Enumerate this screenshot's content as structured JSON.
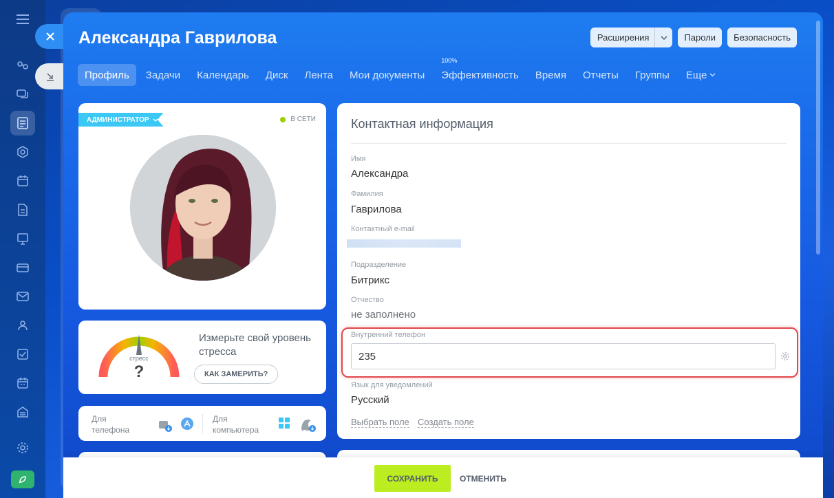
{
  "profile": {
    "name": "Александра Гаврилова"
  },
  "header_actions": {
    "extensions": "Расширения",
    "passwords": "Пароли",
    "security": "Безопасность"
  },
  "tabs": [
    {
      "label": "Профиль",
      "active": true
    },
    {
      "label": "Задачи"
    },
    {
      "label": "Календарь"
    },
    {
      "label": "Диск"
    },
    {
      "label": "Лента"
    },
    {
      "label": "Мои документы"
    },
    {
      "label": "Эффективность",
      "badge": "100%"
    },
    {
      "label": "Время"
    },
    {
      "label": "Отчеты"
    },
    {
      "label": "Группы"
    },
    {
      "label": "Еще"
    }
  ],
  "profile_card": {
    "role_badge": "АДМИНИСТРАТОР",
    "status": "В СЕТИ",
    "status_color": "#9dcf00"
  },
  "stress_card": {
    "gauge_label": "стресс",
    "gauge_value": "?",
    "text": "Измерьте свой уровень стресса",
    "button": "КАК ЗАМЕРИТЬ?"
  },
  "apps_card": {
    "phone_label_1": "Для",
    "phone_label_2": "телефона",
    "desktop_label_1": "Для",
    "desktop_label_2": "компьютера"
  },
  "contact": {
    "title": "Контактная информация",
    "first_name_label": "Имя",
    "first_name": "Александра",
    "last_name_label": "Фамилия",
    "last_name": "Гаврилова",
    "email_label": "Контактный e-mail",
    "department_label": "Подразделение",
    "department": "Битрикс",
    "patronymic_label": "Отчество",
    "patronymic": "не заполнено",
    "phone_label": "Внутренний телефон",
    "phone_value": "235",
    "language_label": "Язык для уведомлений",
    "language": "Русский",
    "choose_field": "Выбрать поле",
    "create_field": "Создать поле"
  },
  "footer": {
    "save": "СОХРАНИТЬ",
    "cancel": "ОТМЕНИТЬ"
  },
  "colors": {
    "accent": "#2f8ef4",
    "save_button": "#bbed21",
    "highlight": "#e0474b",
    "admin_badge": "#3bc8f5"
  }
}
